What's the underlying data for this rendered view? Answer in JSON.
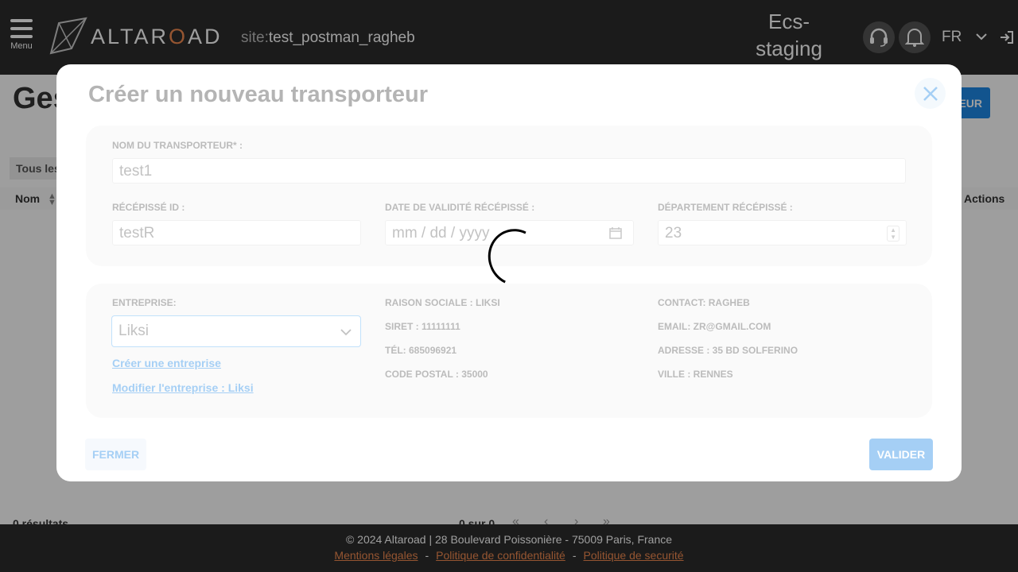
{
  "header": {
    "menu_label": "Menu",
    "logo_text_a": "ALTAR",
    "logo_text_o": "O",
    "logo_text_b": "AD",
    "site_key": "site:",
    "site_value": "test_postman_ragheb",
    "env_line1": "Ecs-",
    "env_line2": "staging",
    "lang": "FR"
  },
  "page": {
    "title": "Ges",
    "add_button": "EUR",
    "filter_tab": "Tous les",
    "col_name": "Nom",
    "col_actions": "Actions",
    "results": "0 résultats",
    "pager": "0 sur 0"
  },
  "footer": {
    "copyright": "© 2024 Altaroad | 28 Boulevard Poissonière - 75009 Paris, France",
    "link1": "Mentions légales",
    "link2": "Politique de confidentialité",
    "link3": "Politique de securité",
    "sep": "-"
  },
  "modal": {
    "title": "Créer un nouveau transporteur",
    "carrier_name_label": "NOM DU TRANSPORTEUR* :",
    "carrier_name_value": "test1",
    "receipt_id_label": "RÉCÉPISSÉ ID :",
    "receipt_id_value": "testR",
    "validity_date_label": "DATE DE VALIDITÉ RÉCÉPISSÉ :",
    "validity_date_placeholder": "mm / dd / yyyy",
    "department_label": "DÉPARTEMENT RÉCÉPISSÉ :",
    "department_value": "23",
    "company_label": "ENTREPRISE:",
    "company_value": "Liksi",
    "create_company_link": "Créer une entreprise",
    "edit_company_link": "Modifier l'entreprise : Liksi",
    "company_name": "RAISON SOCIALE : LIKSI",
    "siret": "SIRET : 11111111",
    "phone": "TÉL: 685096921",
    "postal_code": "CODE POSTAL : 35000",
    "contact": "CONTACT: RAGHEB",
    "email": "EMAIL: ZR@GMAIL.COM",
    "address": "ADRESSE : 35 BD SOLFERINO",
    "city": "VILLE : RENNES",
    "close_button": "FERMER",
    "validate_button": "VALIDER"
  },
  "colors": {
    "accent": "#1e88e5",
    "brand_orange": "#f08a50",
    "header_bg": "#2d2d2d"
  }
}
